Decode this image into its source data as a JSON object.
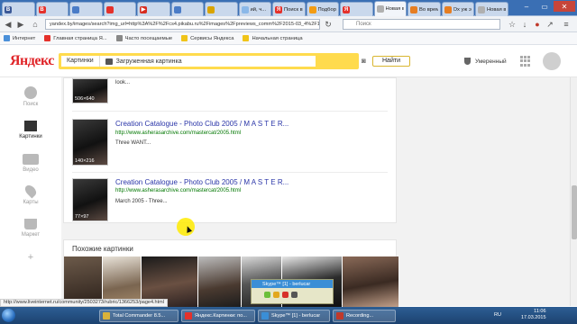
{
  "browser": {
    "tabs": [
      {
        "label": "",
        "color": "#3b5998",
        "glyph": "B"
      },
      {
        "label": "",
        "color": "#e4312b",
        "glyph": "B"
      },
      {
        "label": "",
        "color": "#4a7cc7",
        "glyph": ""
      },
      {
        "label": "",
        "color": "#e4312b",
        "glyph": ""
      },
      {
        "label": "",
        "color": "#d72c1f",
        "glyph": "▶"
      },
      {
        "label": "",
        "color": "#4a7cc7",
        "glyph": ""
      },
      {
        "label": "",
        "color": "#d9a400",
        "glyph": ""
      },
      {
        "label": "ий, ч...",
        "color": "#8bb8e8",
        "glyph": ""
      },
      {
        "label": "Поиск в ...",
        "color": "#e4312b",
        "glyph": "Я"
      },
      {
        "label": "Подбор с...",
        "color": "#f39c12",
        "glyph": ""
      },
      {
        "label": "",
        "color": "#e4312b",
        "glyph": "Я"
      },
      {
        "label": "Новая вкладка",
        "color": "#b0b0b0",
        "glyph": ""
      },
      {
        "label": "Во времен...",
        "color": "#e67e22",
        "glyph": ""
      },
      {
        "label": "Ох уж эти...",
        "color": "#e67e22",
        "glyph": ""
      },
      {
        "label": "Новая вкладка",
        "color": "#b0b0b0",
        "glyph": ""
      }
    ],
    "address": "yandex.by/images/search?img_url=http%3A%2F%2Fcs4.pikabu.ru%2Fimages%2Fpreviews_comm%2F2015-03_4%2F1426337029",
    "search_placeholder": "Поиск",
    "bookmarks": [
      "Интернет",
      "Главная страница Я...",
      "Часто посещаемые",
      "Сервисы Яндекса",
      "Начальная страница"
    ]
  },
  "yandex": {
    "logo": "Яндекс",
    "search_category": "Картинки",
    "search_value": "Загруженная картинка",
    "search_button": "Найти",
    "filter_label": "Умеренный"
  },
  "sidebar": [
    {
      "label": "Поиск",
      "active": false
    },
    {
      "label": "Картинки",
      "active": true
    },
    {
      "label": "Видео",
      "active": false
    },
    {
      "label": "Карты",
      "active": false
    },
    {
      "label": "Маркет",
      "active": false
    },
    {
      "label": "+",
      "active": false
    }
  ],
  "results": [
    {
      "title": "",
      "url": "",
      "snippet": "look...",
      "dims": "506×640"
    },
    {
      "title": "Creation Catalogue - Photo Club 2005 / M A S T E R...",
      "url": "http://www.asherasarchive.com/mastercat/2005.html",
      "snippet": "Three WANT...",
      "dims": "140×216"
    },
    {
      "title": "Creation Catalogue - Photo Club 2005 / M A S T E R...",
      "url": "http://www.asherasarchive.com/mastercat/2005.html",
      "snippet": "March 2005 - Three...",
      "dims": "77×97"
    }
  ],
  "similar": {
    "title": "Похожие картинки"
  },
  "status_url": "http://www.liveinternet.ru/community/2503273/rubric/1366253/page4.html",
  "skype": {
    "title": "Skype™ [1] - berlucar"
  },
  "taskbar": {
    "items": [
      {
        "label": "Total Commander 8.5...",
        "color": "#d9b23a"
      },
      {
        "label": "Яндекс.Картинки: по...",
        "color": "#e4312b"
      },
      {
        "label": "Skype™ [1] - berlucar",
        "color": "#3a8ed6"
      },
      {
        "label": "Recording...",
        "color": "#c0392b"
      }
    ],
    "lang": "RU",
    "time": "11:06",
    "date": "17.03.2015"
  }
}
